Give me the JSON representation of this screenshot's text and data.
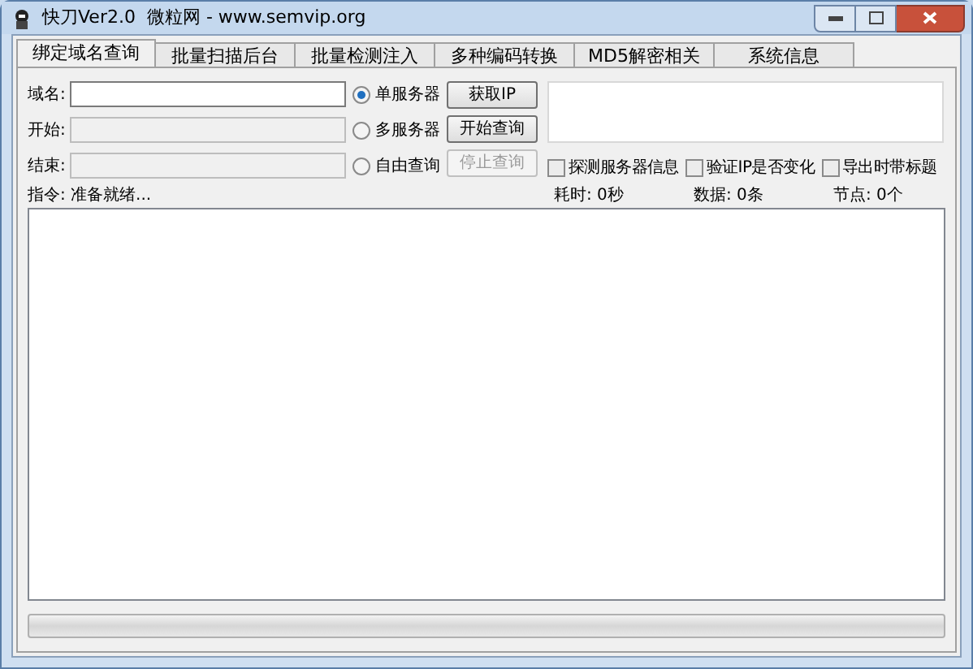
{
  "window": {
    "title": "快刀Ver2.0  微粒网 - www.semvip.org"
  },
  "tabs": [
    {
      "label": "绑定域名查询",
      "selected": true
    },
    {
      "label": "批量扫描后台",
      "selected": false
    },
    {
      "label": "批量检测注入",
      "selected": false
    },
    {
      "label": "多种编码转换",
      "selected": false
    },
    {
      "label": "MD5解密相关",
      "selected": false
    },
    {
      "label": "系统信息",
      "selected": false
    }
  ],
  "fields": [
    {
      "label": "域名:",
      "disabled": false
    },
    {
      "label": "开始:",
      "disabled": true
    },
    {
      "label": "结束:",
      "disabled": true
    }
  ],
  "radios": [
    {
      "label": "单服务器",
      "selected": true
    },
    {
      "label": "多服务器",
      "selected": false
    },
    {
      "label": "自由查询",
      "selected": false
    }
  ],
  "buttons": [
    {
      "label": "获取IP",
      "disabled": false
    },
    {
      "label": "开始查询",
      "disabled": false
    },
    {
      "label": "停止查询",
      "disabled": true
    }
  ],
  "checkboxes": [
    {
      "label": "探测服务器信息",
      "checked": false
    },
    {
      "label": "验证IP是否变化",
      "checked": false
    },
    {
      "label": "导出时带标题",
      "checked": false
    }
  ],
  "status": {
    "command": "指令: 准备就绪...",
    "elapsed": "耗时: 0秒",
    "data": "数据: 0条",
    "nodes": "节点: 0个"
  },
  "progress": {
    "level": 0
  }
}
